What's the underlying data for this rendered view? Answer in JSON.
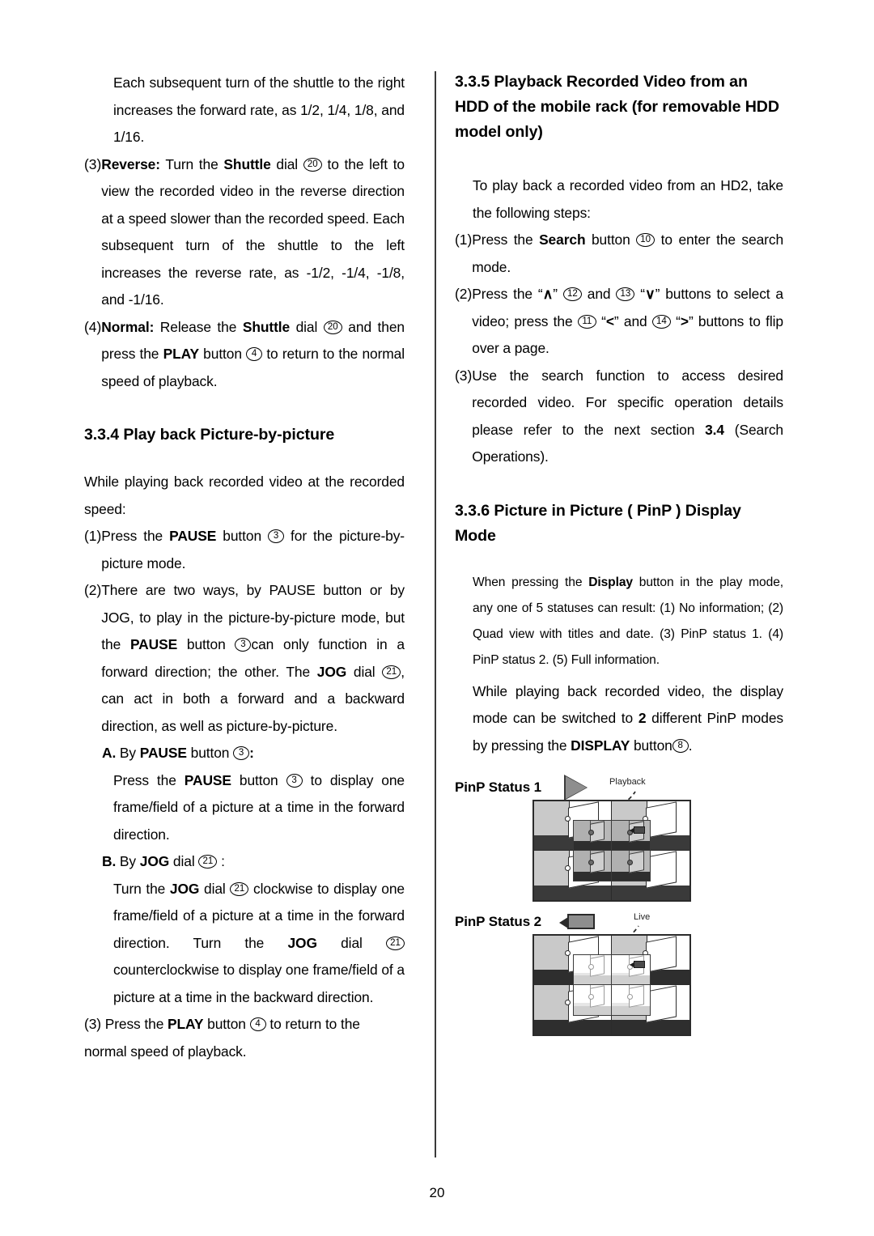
{
  "page": {
    "number": "20"
  },
  "left_column": {
    "para_shuttle_cont": {
      "text": "Each subsequent turn of the shuttle to the right increases the forward rate, as 1/2, 1/4, 1/8, and 1/16."
    },
    "item3": {
      "marker": "(3)",
      "lead": "Reverse:",
      "t1": " Turn the ",
      "b1": "Shuttle",
      "t2": " dial ",
      "c1": "20",
      "t3": " to the left to view the recorded video in the reverse direction at a speed slower than the recorded speed. Each subsequent turn of the shuttle to the left increases the reverse rate, as -1/2, -1/4, -1/8, and -1/16."
    },
    "item4": {
      "marker": "(4)",
      "lead": "Normal:",
      "t1": "  Release the ",
      "b1": "Shuttle",
      "t2": " dial ",
      "c1": "20",
      "t3": " and then press the ",
      "b2": "PLAY",
      "t4": " button ",
      "c2": "4",
      "t5": " to return to the normal speed of playback."
    },
    "heading_334": "3.3.4 Play back Picture-by-picture",
    "intro": "While playing back recorded video at the recorded speed:",
    "item1": {
      "marker": "(1)",
      "t1": " Press the ",
      "b1": "PAUSE",
      "t2": " button ",
      "c1": "3",
      "t3": " for the picture-by-picture mode."
    },
    "item2": {
      "marker": "(2)",
      "t1": "There are two ways, by PAUSE button or by JOG, to play in the picture-by-picture mode, but the ",
      "b1": "PAUSE",
      "t2": " button ",
      "c1": "3",
      "t3": "can only function in a forward direction; the other. The ",
      "b2": "JOG",
      "t4": " dial ",
      "c2": "21",
      "t5": ", can act in both a forward and a backward direction, as well as picture-by-picture."
    },
    "itemA": {
      "marker": "A.",
      "t1": " By ",
      "b1": "PAUSE",
      "t2": " button ",
      "c1": "3",
      "t3": ":"
    },
    "itemA_body": {
      "t1": "Press the ",
      "b1": "PAUSE",
      "t2": " button ",
      "c1": "3",
      "t3": " to display one frame/field of a picture at a time in the forward direction."
    },
    "itemB": {
      "marker": "B.",
      "t1": " By ",
      "b1": "JOG",
      "t2": " dial ",
      "c1": "21",
      "t3": " :"
    },
    "itemB_body": {
      "t1": "Turn the ",
      "b1": "JOG",
      "t2": " dial ",
      "c1": "21",
      "t3": " clockwise to display one frame/field of a picture at a time in the forward direction. Turn the ",
      "b2": "JOG",
      "t4": " dial ",
      "c2": "21",
      "t5": " counterclockwise to display one frame/field of a picture at a time in the backward direction."
    },
    "item3b": {
      "marker": "(3)",
      "t1": " Press the ",
      "b1": "PLAY",
      "t2": " button ",
      "c1": "4",
      "t3": " to return to the normal speed of playback."
    }
  },
  "right_column": {
    "heading_335": "3.3.5 Playback Recorded Video from an HDD of the mobile rack (for removable HDD model only)",
    "intro_335": "To play back a recorded video from an HD2, take the following steps:",
    "step1": {
      "marker": "(1)",
      "t1": "  Press the ",
      "b1": "Search",
      "t2": " button ",
      "c1": "10",
      "t3": " to enter the search mode."
    },
    "step2": {
      "marker": "(2)",
      "t1": " Press the  “",
      "b1": "∧",
      "t2": "” ",
      "c1": "12",
      "t3": " and ",
      "c2": "13",
      "t4": " “",
      "b2": "∨",
      "t5": "” buttons to select a video; press the ",
      "c3": "11",
      "t6": " “",
      "b3": "<",
      "t7": "” and ",
      "c4": "14",
      "t8": " “",
      "b4": ">",
      "t9": "” buttons to flip over a page."
    },
    "step3": {
      "marker": "(3)",
      "t1": " Use the search function to access desired recorded video. For specific operation details please refer to the next section ",
      "b1": "3.4",
      "t2": " (Search Operations)."
    },
    "heading_336": "3.3.6 Picture in Picture ( PinP ) Display Mode",
    "para_display": {
      "t1": "When pressing the ",
      "b1": "Display",
      "t2": " button in the play mode, any one of 5 statuses can result: (1) No information; (2) Quad view with titles and date. (3) PinP status 1. (4) PinP status 2. (5) Full information."
    },
    "para_modes": {
      "t1": "While playing back recorded video, the display mode can be switched to ",
      "b1": "2",
      "t2": " different PinP modes by pressing the ",
      "b2": "DISPLAY",
      "t3": " button",
      "c1": "8",
      "t4": "."
    },
    "figures": [
      {
        "label": "PinP Status 1",
        "icon": "play-triangle-icon",
        "caption": "Playback"
      },
      {
        "label": "PinP Status 2",
        "icon": "video-camera-icon",
        "caption": "Live"
      }
    ]
  }
}
